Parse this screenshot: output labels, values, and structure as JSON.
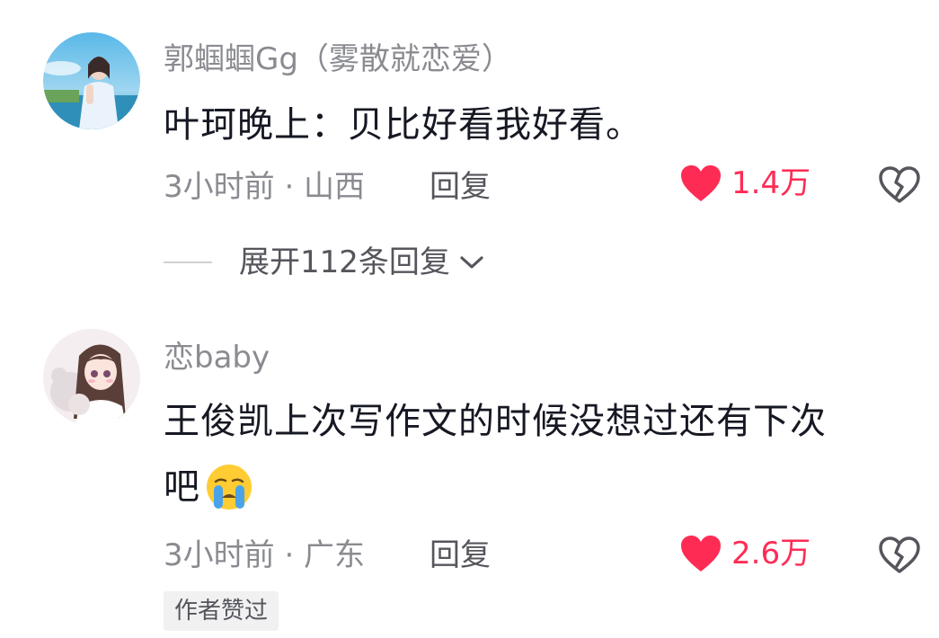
{
  "comments": [
    {
      "username": "郭蝈蝈Gg（雾散就恋爱）",
      "text_lines": [
        "叶珂晚上：贝比好看我好看。"
      ],
      "meta": "3小时前 · 山西",
      "reply_label": "回复",
      "like_count": "1.4万",
      "expand_label": "展开112条回复"
    },
    {
      "username": "恋baby",
      "text_lines": [
        "王俊凯上次写作文的时候没想过还有下次",
        "吧"
      ],
      "meta": "3小时前 · 广东",
      "reply_label": "回复",
      "like_count": "2.6万",
      "badge": "作者赞过"
    }
  ],
  "colors": {
    "like": "#fe2c55",
    "secondary_text": "#8a8b91",
    "primary_text": "#161823"
  },
  "icons": [
    "heart-icon",
    "broken-heart-icon",
    "chevron-down-icon",
    "crying-emoji"
  ]
}
